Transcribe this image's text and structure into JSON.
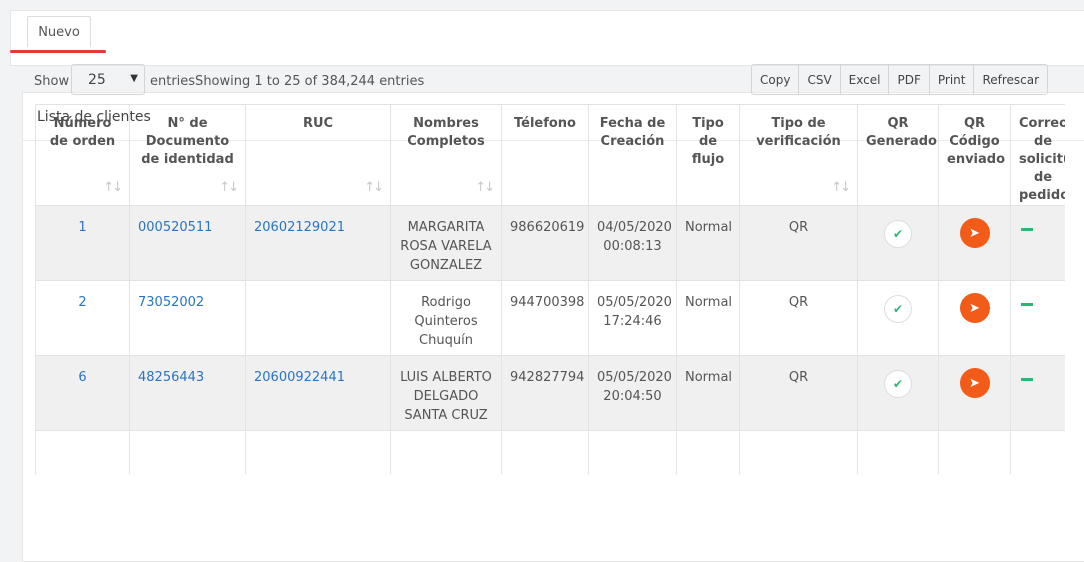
{
  "top": {
    "new_label": "Nuevo"
  },
  "panel": {
    "title": "Lista de clientes",
    "show_label": "Show",
    "page_size": "25",
    "entries_label": "entriesShowing 1 to 25 of 384,244 entries",
    "buttons": [
      "Copy",
      "CSV",
      "Excel",
      "PDF",
      "Print",
      "Refrescar"
    ]
  },
  "table": {
    "headers": [
      "Número de orden",
      "N° de Documento de identidad",
      "RUC",
      "Nombres Completos",
      "Télefono",
      "Fecha de Creación",
      "Tipo de flujo",
      "Tipo de verificación",
      "QR Generado",
      "QR Código enviado",
      "Correo de solicitud de pedido"
    ],
    "rows": [
      {
        "orden": "1",
        "documento": "000520511",
        "ruc": "20602129021",
        "nombres": "MARGARITA ROSA VARELA GONZALEZ",
        "telefono": "986620619",
        "fecha": "04/05/2020 00:08:13",
        "flujo": "Normal",
        "verificacion": "QR"
      },
      {
        "orden": "2",
        "documento": "73052002",
        "ruc": "",
        "nombres": "Rodrigo Quinteros Chuquín",
        "telefono": "944700398",
        "fecha": "05/05/2020 17:24:46",
        "flujo": "Normal",
        "verificacion": "QR"
      },
      {
        "orden": "6",
        "documento": "48256443",
        "ruc": "20600922441",
        "nombres": "LUIS ALBERTO DELGADO SANTA CRUZ",
        "telefono": "942827794",
        "fecha": "05/05/2020 20:04:50",
        "flujo": "Normal",
        "verificacion": "QR"
      }
    ]
  },
  "icons": {
    "check": "check-icon",
    "send": "paper-plane-icon",
    "sort": "sort-icon"
  },
  "colors": {
    "accent_red": "#e53935",
    "link": "#2a74c4",
    "send_orange": "#f35b18",
    "check_green": "#2bb673"
  }
}
